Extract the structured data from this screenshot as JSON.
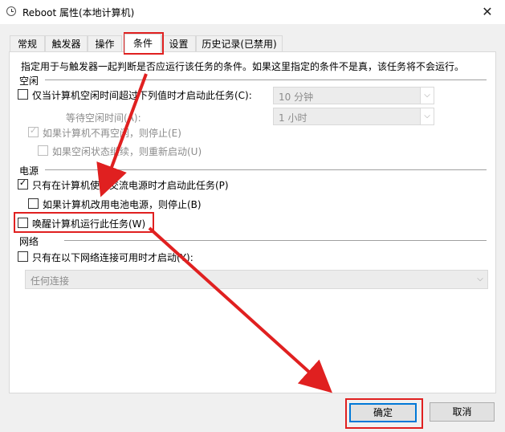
{
  "window": {
    "title": "Reboot 属性(本地计算机)",
    "close_glyph": "✕"
  },
  "tabs": [
    "常规",
    "触发器",
    "操作",
    "条件",
    "设置",
    "历史记录(已禁用)"
  ],
  "active_tab": "条件",
  "description": "指定用于与触发器一起判断是否应运行该任务的条件。如果这里指定的条件不是真，该任务将不会运行。",
  "idle": {
    "heading": "空闲",
    "start_if_idle": {
      "label": "仅当计算机空闲时间超过下列值时才启动此任务(C):",
      "checked": false
    },
    "idle_duration": "10 分钟",
    "wait_label": "等待空闲时间(A):",
    "wait_duration": "1 小时",
    "stop_if_not_idle": {
      "label": "如果计算机不再空闲，则停止(E)",
      "checked": true
    },
    "restart_if_idle": {
      "label": "如果空闲状态继续，则重新启动(U)",
      "checked": false
    }
  },
  "power": {
    "heading": "电源",
    "ac_only": {
      "label": "只有在计算机使用交流电源时才启动此任务(P)",
      "checked": true
    },
    "stop_on_battery": {
      "label": "如果计算机改用电池电源，则停止(B)",
      "checked": false
    },
    "wake_to_run": {
      "label": "唤醒计算机运行此任务(W)",
      "checked": false
    }
  },
  "network": {
    "heading": "网络",
    "only_if_network": {
      "label": "只有在以下网络连接可用时才启动(Y):",
      "checked": false
    },
    "connection": "任何连接"
  },
  "buttons": {
    "ok": "确定",
    "cancel": "取消"
  },
  "glyphs": {
    "check": "✓",
    "dropdown": "⌵"
  },
  "annotation_color": "#e02020"
}
